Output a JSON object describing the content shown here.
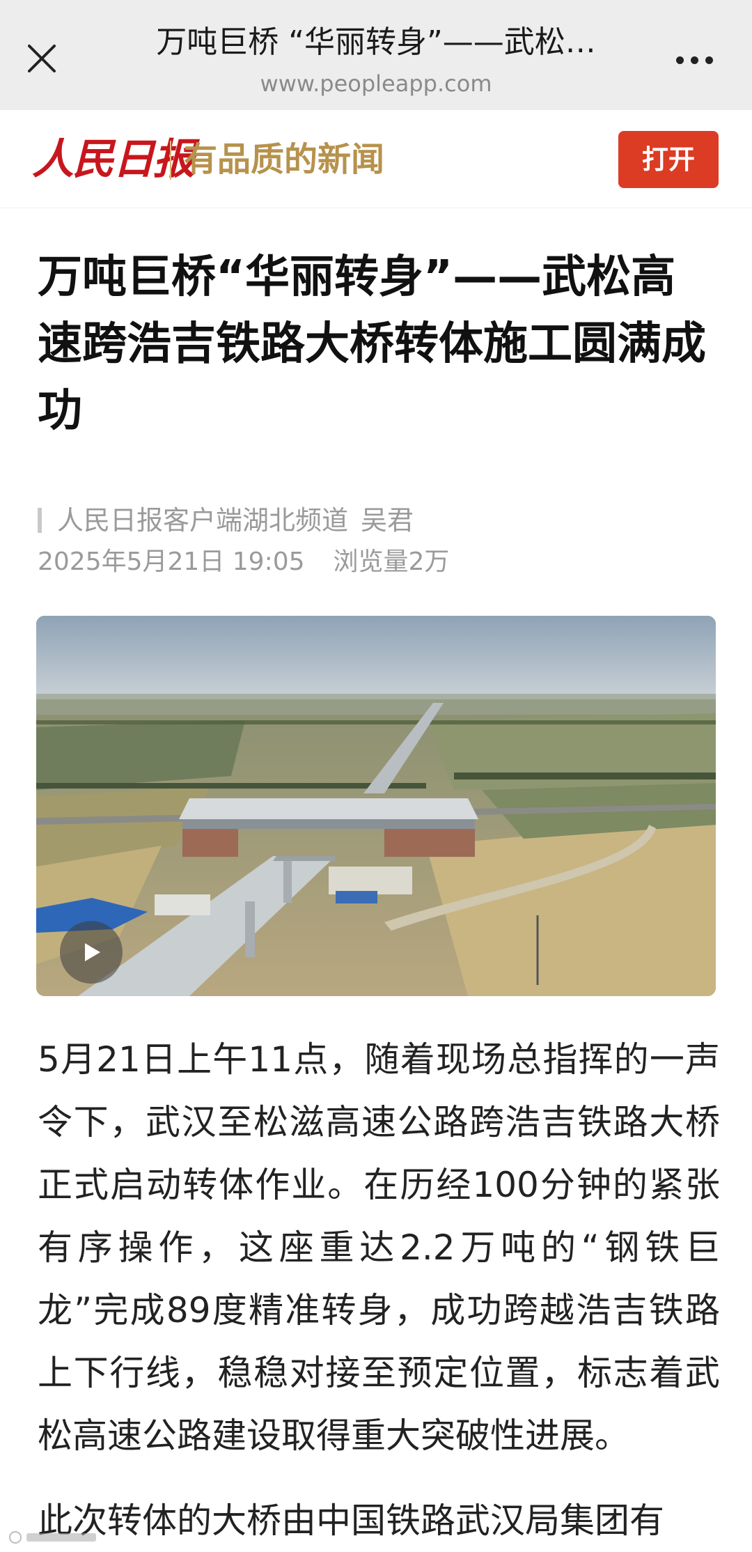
{
  "browser": {
    "title": "万吨巨桥 “华丽转身”——武松…",
    "url": "www.peopleapp.com"
  },
  "brand": {
    "logo": "人民日报",
    "slogan": "有品质的新闻",
    "open_label": "打开",
    "accent": "#dc3b24"
  },
  "article": {
    "headline": "万吨巨桥“华丽转身”——武松高速跨浩吉铁路大桥转体施工圆满成功",
    "source": "人民日报客户端湖北频道",
    "author": "吴君",
    "datetime": "2025年5月21日 19:05",
    "views": "浏览量2万",
    "media_icon": "play-icon",
    "paragraph1": "5月21日上午11点，随着现场总指挥的一声令下，武汉至松滋高速公路跨浩吉铁路大桥正式启动转体作业。在历经100分钟的紧张有序操作，这座重达2.2万吨的“钢铁巨龙”完成89度精准转身，成功跨越浩吉铁路上下行线，稳稳对接至预定位置，标志着武松高速公路建设取得重大突破性进展。",
    "paragraph2": "此次转体的大桥由中国铁路武汉局集团有"
  }
}
